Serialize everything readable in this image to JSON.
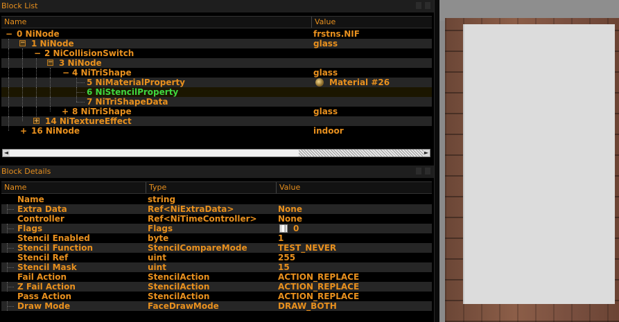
{
  "block_list": {
    "title": "Block List",
    "columns": {
      "name": "Name",
      "value": "Value"
    },
    "rows": [
      {
        "label": "0 NiNode",
        "value": "frstns.NIF"
      },
      {
        "label": "1 NiNode",
        "value": "glass"
      },
      {
        "label": "2 NiCollisionSwitch",
        "value": ""
      },
      {
        "label": "3 NiNode",
        "value": ""
      },
      {
        "label": "4 NiTriShape",
        "value": "glass"
      },
      {
        "label": "5 NiMaterialProperty",
        "value": "Material #26"
      },
      {
        "label": "6 NiStencilProperty",
        "value": ""
      },
      {
        "label": "7 NiTriShapeData",
        "value": ""
      },
      {
        "label": "8 NiTriShape",
        "value": "glass"
      },
      {
        "label": "14 NiTextureEffect",
        "value": ""
      },
      {
        "label": "16 NiNode",
        "value": "indoor"
      }
    ],
    "selected_row": "6 NiStencilProperty"
  },
  "block_details": {
    "title": "Block Details",
    "columns": {
      "name": "Name",
      "type": "Type",
      "value": "Value"
    },
    "rows": [
      {
        "name": "Name",
        "type": "string",
        "value": ""
      },
      {
        "name": "Extra Data",
        "type": "Ref<NiExtraData>",
        "value": "None"
      },
      {
        "name": "Controller",
        "type": "Ref<NiTimeController>",
        "value": "None"
      },
      {
        "name": "Flags",
        "type": "Flags",
        "value": "0"
      },
      {
        "name": "Stencil Enabled",
        "type": "byte",
        "value": "1"
      },
      {
        "name": "Stencil Function",
        "type": "StencilCompareMode",
        "value": "TEST_NEVER"
      },
      {
        "name": "Stencil Ref",
        "type": "uint",
        "value": "255"
      },
      {
        "name": "Stencil Mask",
        "type": "uint",
        "value": "15"
      },
      {
        "name": "Fail Action",
        "type": "StencilAction",
        "value": "ACTION_REPLACE"
      },
      {
        "name": "Z Fail Action",
        "type": "StencilAction",
        "value": "ACTION_REPLACE"
      },
      {
        "name": "Pass Action",
        "type": "StencilAction",
        "value": "ACTION_REPLACE"
      },
      {
        "name": "Draw Mode",
        "type": "FaceDrawMode",
        "value": "DRAW_BOTH"
      }
    ]
  },
  "icons": {
    "material": "material-sphere-icon",
    "flags": "flags-icon",
    "expand": "plus-icon",
    "collapse": "minus-icon"
  },
  "colors": {
    "text": "#e8901e",
    "selected": "#3fd73f",
    "background": "#000000"
  }
}
